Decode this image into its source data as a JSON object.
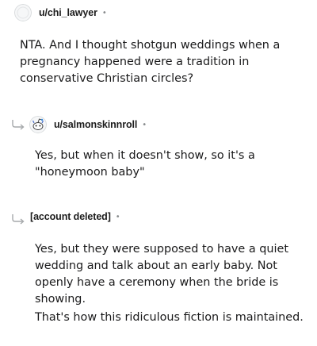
{
  "comments": [
    {
      "username": "u/chi_lawyer",
      "separator": "•",
      "paragraphs": [
        "NTA. And I thought shotgun weddings when a pregnancy happened were a tradition in conservative Christian circles?"
      ],
      "avatar_icon": "default-avatar-icon"
    },
    {
      "username": "u/salmonskinnroll",
      "separator": "•",
      "paragraphs": [
        "Yes, but when it doesn't show, so it's a \"honeymoon baby\""
      ],
      "avatar_icon": "snoo-avatar-icon",
      "reply_icon": "reply-arrow-icon"
    },
    {
      "username": "[account deleted]",
      "separator": "•",
      "paragraphs": [
        "Yes, but they were supposed to have a quiet wedding and talk about an early baby. Not openly have a ceremony when the bride is showing.",
        "That's how this ridiculous fiction is maintained."
      ],
      "reply_icon": "reply-arrow-icon"
    }
  ]
}
